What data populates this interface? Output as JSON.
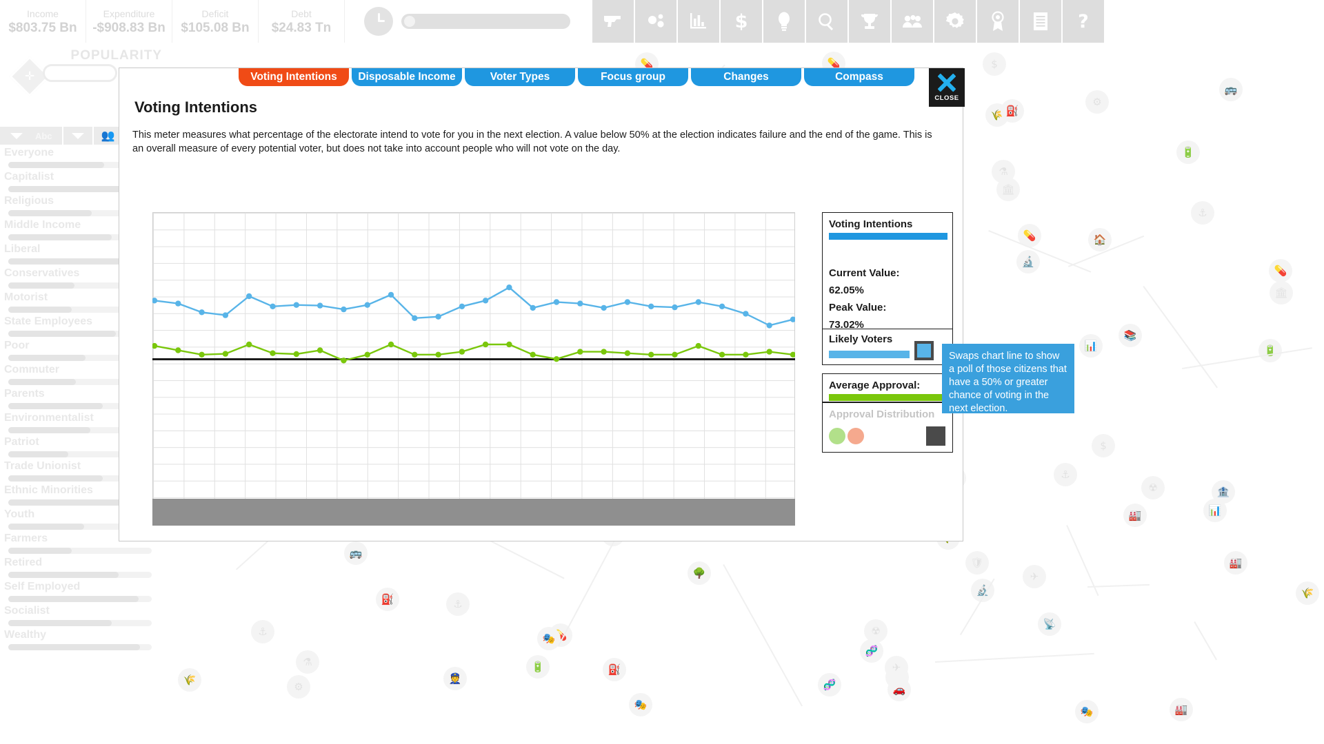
{
  "topbar": {
    "finance": [
      {
        "label": "Income",
        "value": "$803.75 Bn"
      },
      {
        "label": "Expenditure",
        "value": "-$908.83 Bn"
      },
      {
        "label": "Deficit",
        "value": "$105.08 Bn"
      },
      {
        "label": "Debt",
        "value": "$24.83 Tn"
      }
    ],
    "turn_clock_icon": "clock-icon",
    "tools": [
      {
        "name": "military-icon",
        "glyph": "pistol"
      },
      {
        "name": "bubbles-icon",
        "glyph": "bubbles"
      },
      {
        "name": "bar-chart-icon",
        "glyph": "chart"
      },
      {
        "name": "dollar-icon",
        "glyph": "$"
      },
      {
        "name": "lightbulb-icon",
        "glyph": "bulb"
      },
      {
        "name": "search-icon",
        "glyph": "search"
      },
      {
        "name": "trophy-icon",
        "glyph": "trophy"
      },
      {
        "name": "people-icon",
        "glyph": "people"
      },
      {
        "name": "settings-gear-icon",
        "glyph": "gear"
      },
      {
        "name": "award-icon",
        "glyph": "award"
      },
      {
        "name": "document-icon",
        "glyph": "doc"
      },
      {
        "name": "help-icon",
        "glyph": "?"
      }
    ]
  },
  "sidebar": {
    "title": "POPULARITY",
    "search_placeholder": "",
    "toolbar": [
      {
        "name": "sort-caret",
        "label": ""
      },
      {
        "name": "alphabetical-sort",
        "label": "Abc"
      },
      {
        "name": "filter-caret",
        "label": ""
      },
      {
        "name": "group-people-icon",
        "label": ""
      },
      {
        "name": "extra-toggle",
        "label": ""
      }
    ],
    "groups": [
      {
        "label": "Everyone",
        "value": 67
      },
      {
        "label": "Capitalist",
        "value": 85
      },
      {
        "label": "Religious",
        "value": 58
      },
      {
        "label": "Middle Income",
        "value": 72
      },
      {
        "label": "Liberal",
        "value": 84
      },
      {
        "label": "Conservatives",
        "value": 46
      },
      {
        "label": "Motorist",
        "value": 44
      },
      {
        "label": "State Employees",
        "value": 75
      },
      {
        "label": "Poor",
        "value": 54
      },
      {
        "label": "Commuter",
        "value": 47
      },
      {
        "label": "Parents",
        "value": 66
      },
      {
        "label": "Environmentalist",
        "value": 57
      },
      {
        "label": "Patriot",
        "value": 42
      },
      {
        "label": "Trade Unionist",
        "value": 66
      },
      {
        "label": "Ethnic Minorities",
        "value": 90
      },
      {
        "label": "Youth",
        "value": 53
      },
      {
        "label": "Farmers",
        "value": 44
      },
      {
        "label": "Retired",
        "value": 77
      },
      {
        "label": "Self Employed",
        "value": 91
      },
      {
        "label": "Socialist",
        "value": 72
      },
      {
        "label": "Wealthy",
        "value": 92
      }
    ]
  },
  "modal": {
    "tabs": [
      {
        "label": "Voting Intentions",
        "active": true
      },
      {
        "label": "Disposable Income",
        "active": false
      },
      {
        "label": "Voter Types",
        "active": false
      },
      {
        "label": "Focus group",
        "active": false
      },
      {
        "label": "Changes",
        "active": false
      },
      {
        "label": "Compass",
        "active": false
      }
    ],
    "close_label": "CLOSE",
    "title": "Voting Intentions",
    "description": "This meter measures what percentage of the electorate intend to vote for you in the next election. A value below 50% at the election indicates failure and the end of the game. This is an overall measure of every potential voter, but does not take into account people who will not vote on the day."
  },
  "info_panel": {
    "title": "Voting Intentions",
    "current_value_label": "Current Value:",
    "current_value": "62.05%",
    "peak_value_label": "Peak Value:",
    "peak_value": "73.02%",
    "likely_voters_label": "Likely Voters",
    "average_approval_label": "Average Approval:",
    "approval_distribution_label": "Approval Distribution",
    "accent_blue": "#1f97e0",
    "accent_green": "#7ac70c",
    "likely_voters_blue": "#58b4e8"
  },
  "tooltip": {
    "text": "Swaps chart line to show a poll of those citizens that have a 50% or greater chance of voting in the next election.",
    "background": "#3aa0dd"
  },
  "chart_data": {
    "type": "line",
    "title": "Voting Intentions",
    "xlabel": "",
    "ylabel": "",
    "ylim": [
      0,
      100
    ],
    "grid": true,
    "legend": "hidden",
    "x": [
      1,
      2,
      3,
      4,
      5,
      6,
      7,
      8,
      9,
      10,
      11,
      12,
      13,
      14,
      15,
      16,
      17,
      18,
      19,
      20,
      21,
      22,
      23,
      24,
      25,
      26,
      27,
      28
    ],
    "series": [
      {
        "name": "Voting Intentions",
        "color": "#58b4e8",
        "values": [
          68.5,
          67.5,
          64.5,
          63.5,
          70.0,
          66.5,
          67.0,
          66.8,
          65.5,
          67.0,
          70.5,
          62.5,
          63.0,
          66.5,
          68.5,
          73.0,
          66.0,
          68.0,
          67.5,
          66.0,
          68.0,
          66.5,
          66.2,
          68.0,
          66.5,
          64.0,
          60.0,
          62.05
        ]
      },
      {
        "name": "Average Approval",
        "color": "#7ac70c",
        "values": [
          53.0,
          51.5,
          50.0,
          50.3,
          53.5,
          50.5,
          50.2,
          51.5,
          48.0,
          50.0,
          53.5,
          50.0,
          50.0,
          51.0,
          53.5,
          53.5,
          50.0,
          48.5,
          51.0,
          51.0,
          50.5,
          50.0,
          50.0,
          53.0,
          50.0,
          50.0,
          51.0,
          50.0
        ]
      }
    ],
    "zero_line": 50
  }
}
